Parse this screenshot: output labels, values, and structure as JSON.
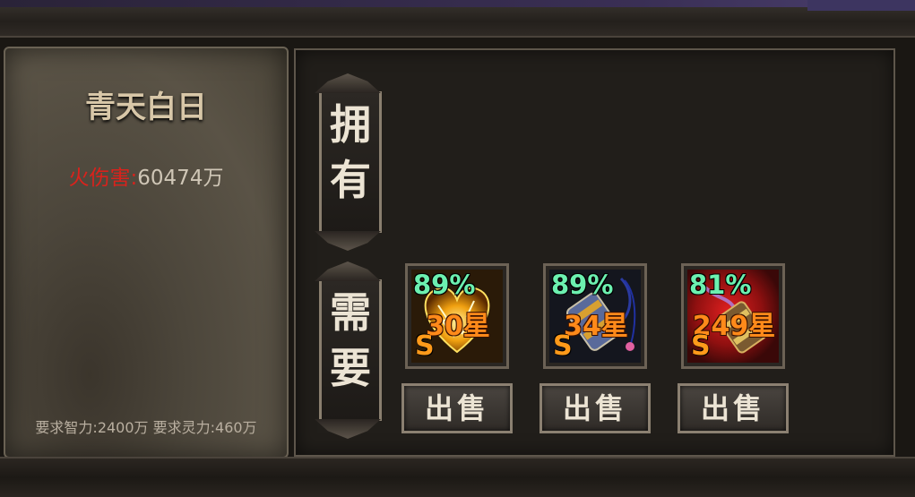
{
  "item": {
    "name": "青天白日",
    "attr_name": "火伤害:",
    "attr_value": "60474万",
    "requirements": "要求智力:2400万 要求灵力:460万"
  },
  "tags": {
    "owned": [
      "拥",
      "有"
    ],
    "need": [
      "需",
      "要"
    ]
  },
  "slots": [
    {
      "percent": "89%",
      "stars": "30星",
      "grade": "S",
      "sell_label": "出售",
      "icon": "golden-heart-icon"
    },
    {
      "percent": "89%",
      "stars": "34星",
      "grade": "S",
      "sell_label": "出售",
      "icon": "scroll-pendant-icon"
    },
    {
      "percent": "81%",
      "stars": "249星",
      "grade": "S",
      "sell_label": "出售",
      "icon": "red-scroll-icon"
    }
  ],
  "colors": {
    "attr_name": "#d9221c",
    "percent": "#6cf0b0",
    "stars": "#ff8a1a"
  }
}
